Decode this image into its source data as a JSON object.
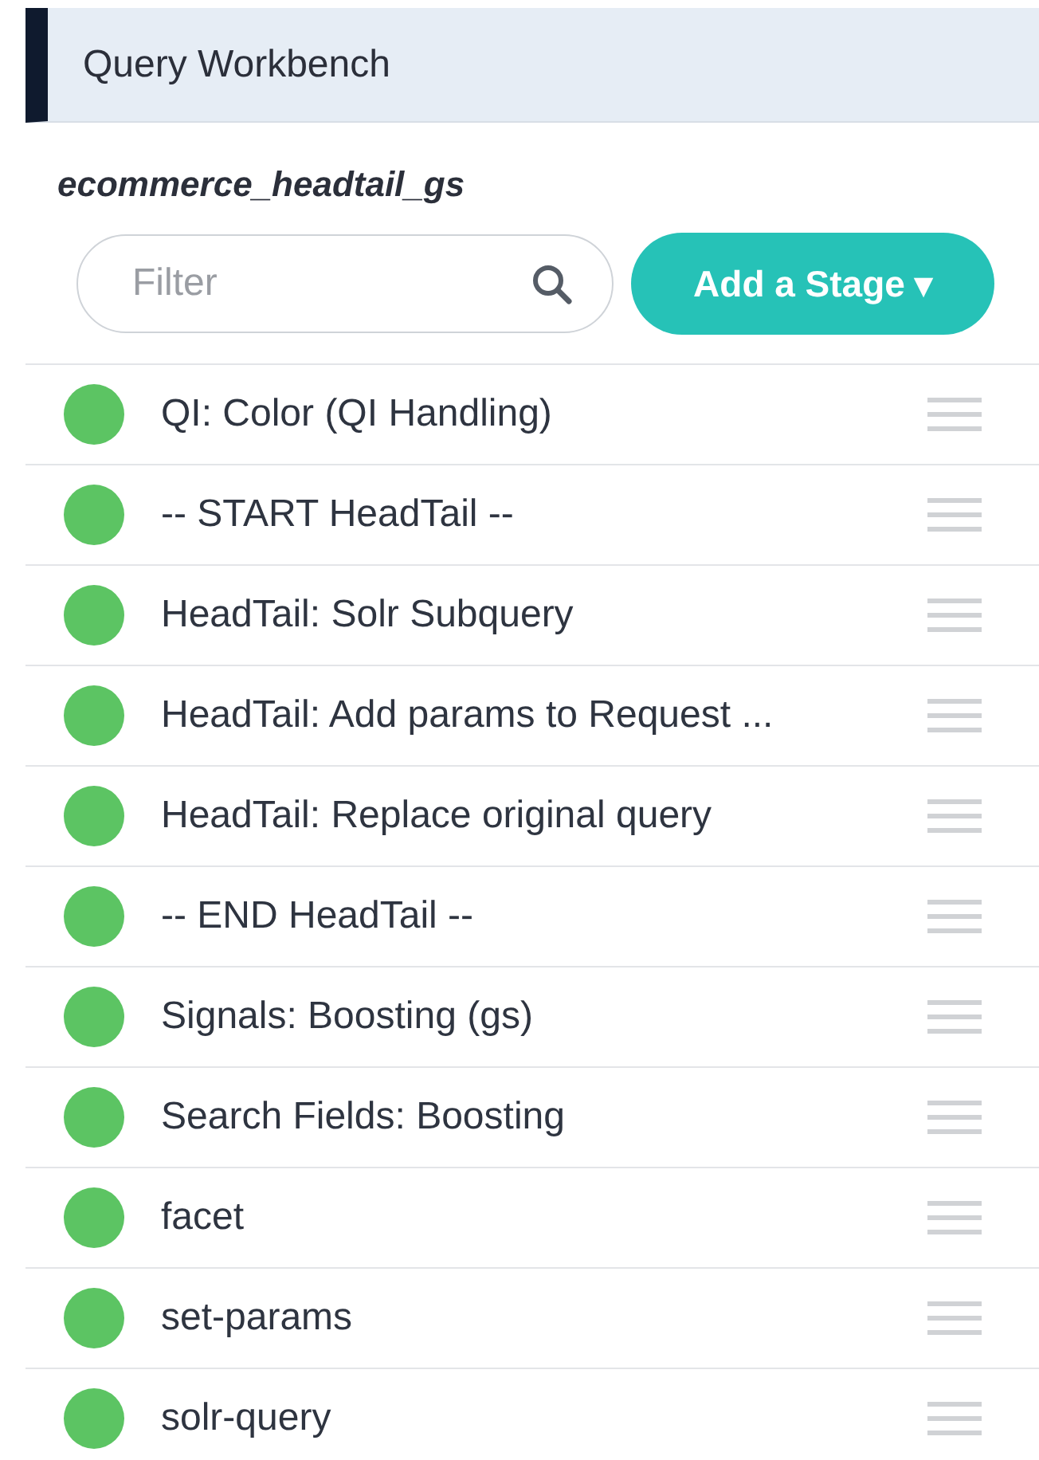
{
  "panel": {
    "title": "Query Workbench",
    "collection": "ecommerce_headtail_gs"
  },
  "filter": {
    "placeholder": "Filter"
  },
  "add_button": {
    "label": "Add a Stage",
    "caret": "▾"
  },
  "stages": [
    {
      "label": "QI: Color (QI Handling)",
      "enabled": true
    },
    {
      "label": "-- START HeadTail --",
      "enabled": true
    },
    {
      "label": "HeadTail: Solr Subquery",
      "enabled": true
    },
    {
      "label": "HeadTail: Add params to Request ...",
      "enabled": true
    },
    {
      "label": "HeadTail: Replace original query",
      "enabled": true
    },
    {
      "label": "-- END HeadTail --",
      "enabled": true
    },
    {
      "label": "Signals: Boosting (gs)",
      "enabled": true
    },
    {
      "label": "Search Fields: Boosting",
      "enabled": true
    },
    {
      "label": "facet",
      "enabled": true
    },
    {
      "label": "set-params",
      "enabled": true
    },
    {
      "label": "solr-query",
      "enabled": true
    }
  ]
}
